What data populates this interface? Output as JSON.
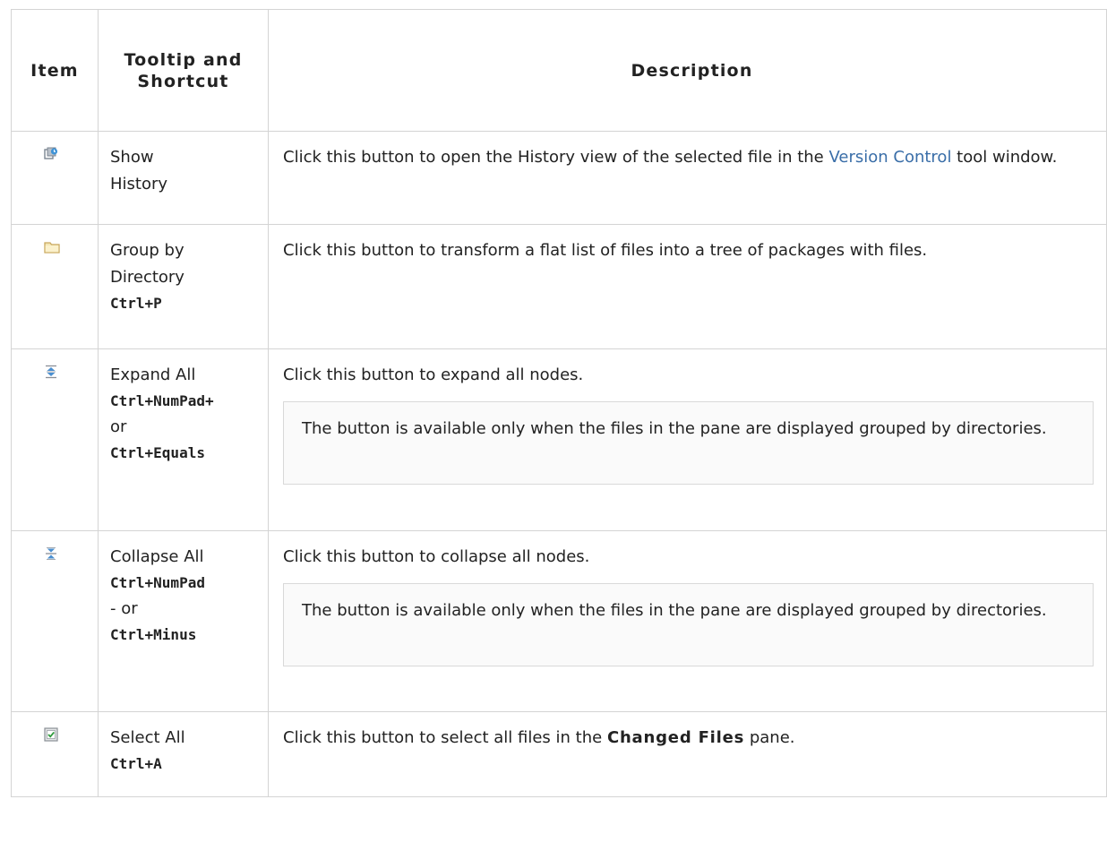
{
  "header": {
    "item": "Item",
    "tooltip": "Tooltip and Shortcut",
    "description": "Description"
  },
  "rows": [
    {
      "icon": "show-history-icon",
      "tooltip": [
        "Show",
        "History"
      ],
      "shortcuts": [],
      "description": {
        "before": "Click this button to open the History view of the selected file in the ",
        "link": "Version Control",
        "after": " tool window."
      }
    },
    {
      "icon": "folder-icon",
      "tooltip": [
        "Group by",
        "Directory"
      ],
      "shortcuts": [
        "Ctrl+P"
      ],
      "description": {
        "text": "Click this button to transform a flat list of files into a tree of packages with files."
      }
    },
    {
      "icon": "expand-all-icon",
      "tooltip": [
        "Expand All"
      ],
      "shortcut_1": "Ctrl+NumPad+",
      "or": "or",
      "shortcut_2": "Ctrl+Equals",
      "description": {
        "text": "Click this button to expand all nodes.",
        "note": "The button is available only when the files in the pane are displayed grouped by directories."
      }
    },
    {
      "icon": "collapse-all-icon",
      "tooltip": [
        "Collapse All"
      ],
      "shortcut_1": "Ctrl+NumPad",
      "or": "- or",
      "shortcut_2": "Ctrl+Minus",
      "description": {
        "text": "Click this button to collapse all nodes.",
        "note": "The button is available only when the files in the pane are displayed grouped by directories."
      }
    },
    {
      "icon": "select-all-icon",
      "tooltip": [
        "Select All"
      ],
      "shortcuts": [
        "Ctrl+A"
      ],
      "description": {
        "before": "Click this button to select all files in the ",
        "bold": "Changed Files",
        "after": " pane."
      }
    }
  ],
  "colors": {
    "link": "#3a6ea8",
    "border": "#d4d4d4",
    "note_background": "#fafafa"
  }
}
